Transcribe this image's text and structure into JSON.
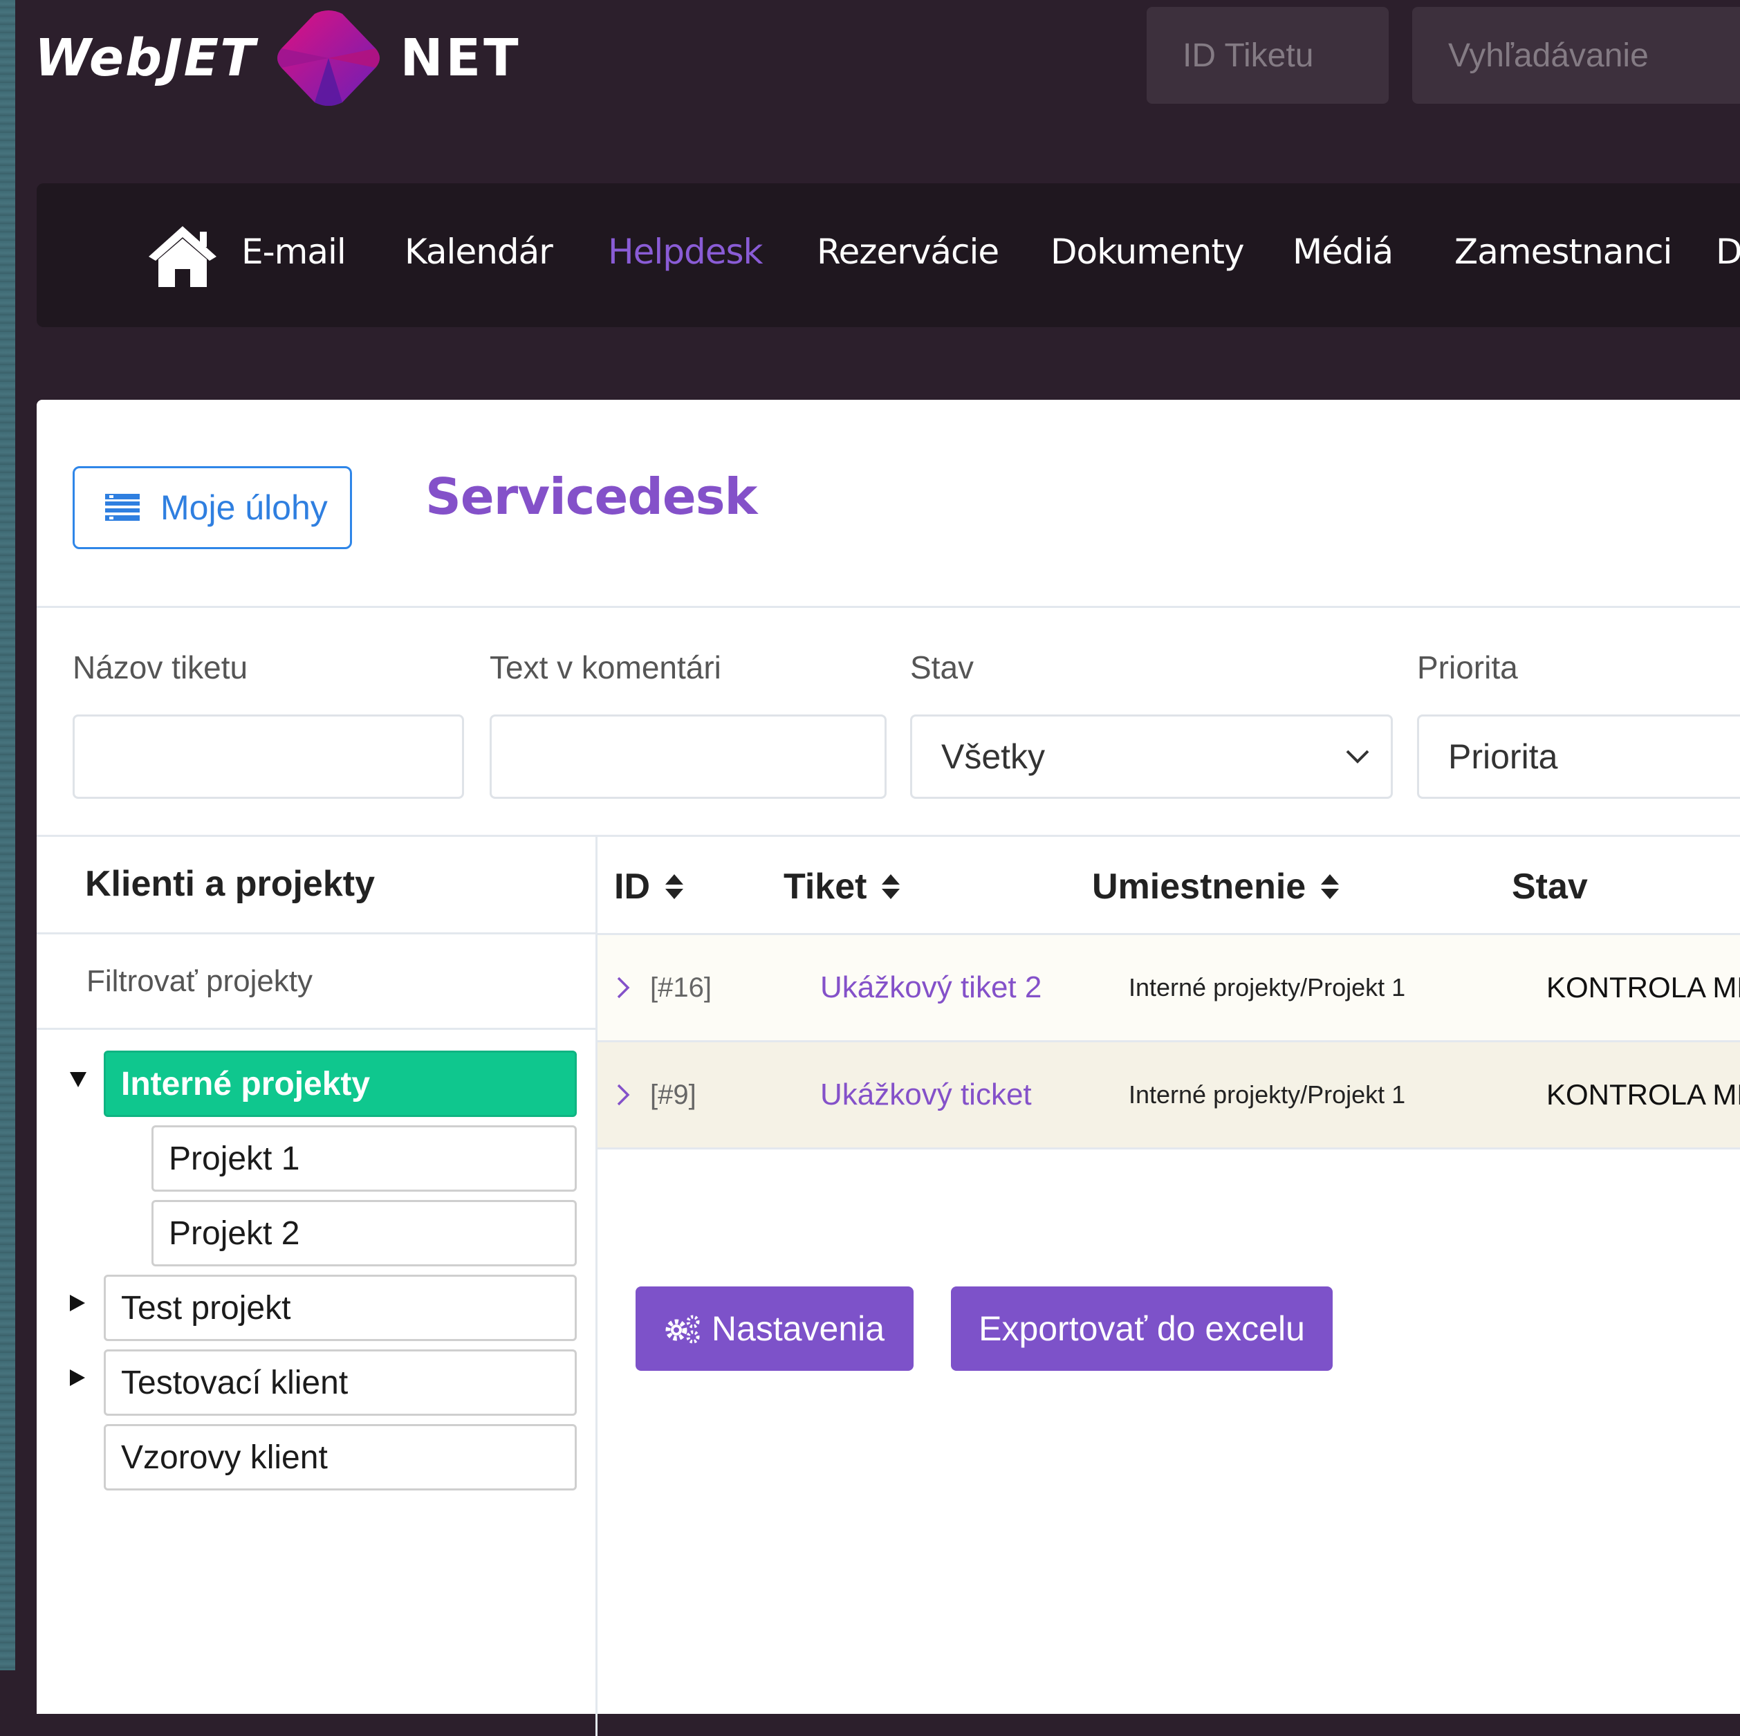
{
  "header": {
    "logo_left": "WebJET",
    "logo_right": "NET",
    "ticket_id_placeholder": "ID Tiketu",
    "search_placeholder": "Vyhľadávanie"
  },
  "nav": {
    "items": [
      {
        "label": "E-mail"
      },
      {
        "label": "Kalendár"
      },
      {
        "label": "Helpdesk",
        "active": true
      },
      {
        "label": "Rezervácie"
      },
      {
        "label": "Dokumenty"
      },
      {
        "label": "Médiá"
      },
      {
        "label": "Zamestnanci"
      },
      {
        "label": "D"
      }
    ]
  },
  "page": {
    "my_tasks_button": "Moje úlohy",
    "title": "Servicedesk"
  },
  "filters": {
    "name_label": "Názov tiketu",
    "name_value": "",
    "comment_label": "Text v komentári",
    "comment_value": "",
    "status_label": "Stav",
    "status_value": "Všetky",
    "priority_label": "Priorita",
    "priority_value": "Priorita"
  },
  "sidebar": {
    "title": "Klienti a projekty",
    "filter_placeholder": "Filtrovať projekty",
    "tree": [
      {
        "label": "Interné projekty",
        "expanded": true,
        "active": true
      },
      {
        "label": "Projekt 1"
      },
      {
        "label": "Projekt 2"
      },
      {
        "label": "Test projekt",
        "expanded": false
      },
      {
        "label": "Testovací klient",
        "expanded": false
      },
      {
        "label": "Vzorovy klient"
      }
    ]
  },
  "table": {
    "columns": [
      "ID",
      "Tiket",
      "Umiestnenie",
      "Stav"
    ],
    "rows": [
      {
        "id": "[#16]",
        "ticket": "Ukážkový tiket 2",
        "location": "Interné projekty/Projekt 1",
        "status": "KONTROLA MNG"
      },
      {
        "id": "[#9]",
        "ticket": "Ukážkový ticket",
        "location": "Interné projekty/Projekt 1",
        "status": "KONTROLA MNG"
      }
    ]
  },
  "actions": {
    "settings_label": "Nastavenia",
    "export_label": "Exportovať do excelu"
  },
  "colors": {
    "accent_purple": "#8451c9",
    "active_green": "#0fc78e",
    "link_blue": "#2f86e8",
    "header_bg": "#2c1f2c",
    "nav_bg": "#1f171f"
  }
}
